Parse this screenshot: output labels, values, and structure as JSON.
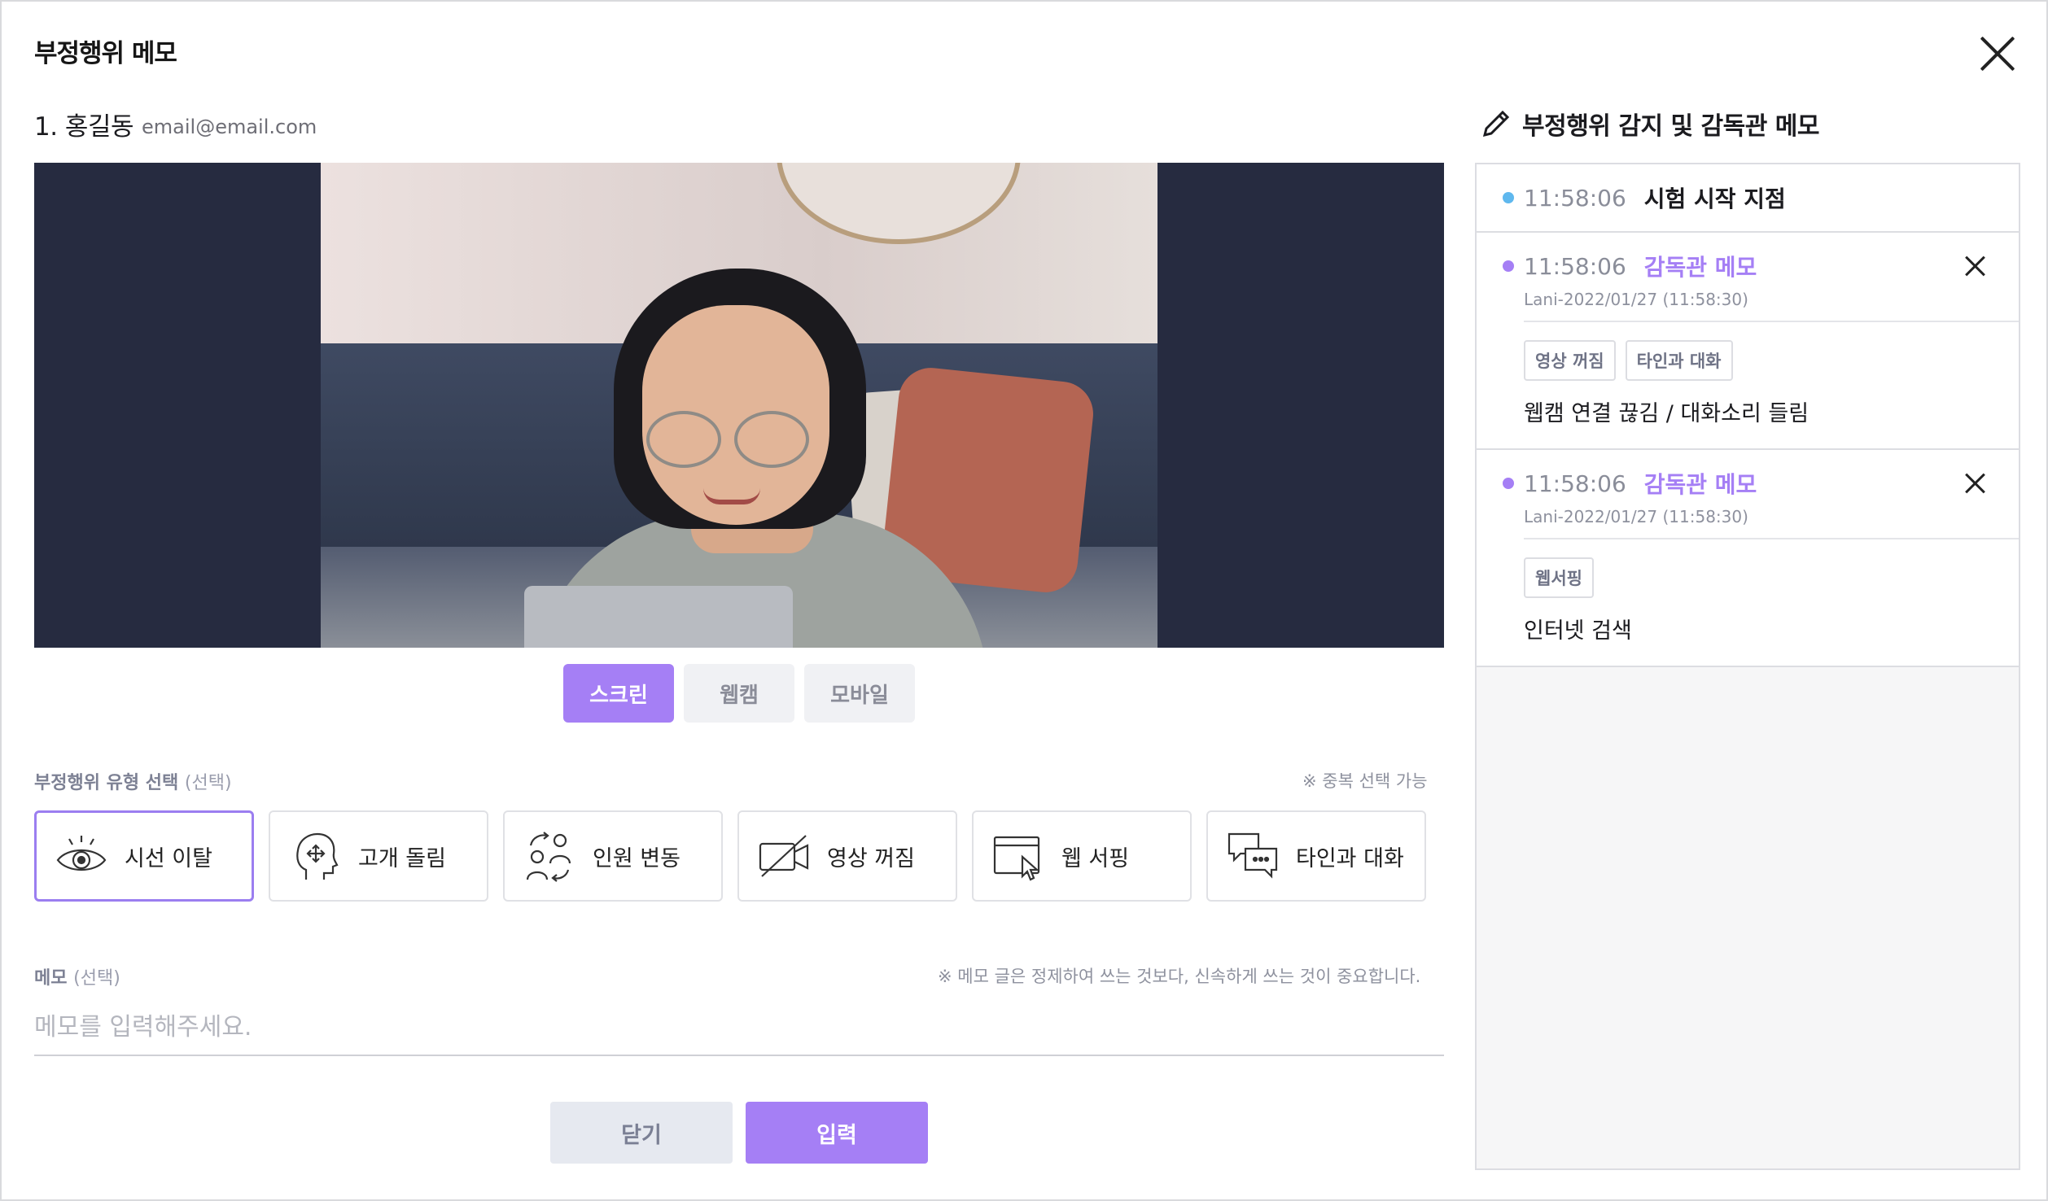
{
  "dialog": {
    "title": "부정행위 메모"
  },
  "candidate": {
    "name": "1. 홍길동",
    "email": "email@email.com"
  },
  "view_tabs": [
    {
      "label": "스크린",
      "active": true
    },
    {
      "label": "웹캠",
      "active": false
    },
    {
      "label": "모바일",
      "active": false
    }
  ],
  "type_section": {
    "label": "부정행위 유형 선택",
    "optional": "(선택)",
    "hint": "※ 중복 선택 가능"
  },
  "types": [
    {
      "label": "시선 이탈",
      "icon": "eye-icon",
      "selected": true
    },
    {
      "label": "고개 돌림",
      "icon": "head-turn-icon",
      "selected": false
    },
    {
      "label": "인원 변동",
      "icon": "people-change-icon",
      "selected": false
    },
    {
      "label": "영상 꺼짐",
      "icon": "video-off-icon",
      "selected": false
    },
    {
      "label": "웹 서핑",
      "icon": "web-cursor-icon",
      "selected": false
    },
    {
      "label": "타인과 대화",
      "icon": "chat-icon",
      "selected": false
    }
  ],
  "memo": {
    "label": "메모",
    "optional": "(선택)",
    "hint": "※ 메모 글은 정제하여 쓰는 것보다, 신속하게 쓰는 것이 중요합니다.",
    "placeholder": "메모를 입력해주세요.",
    "value": ""
  },
  "buttons": {
    "close": "닫기",
    "submit": "입력"
  },
  "sidebar": {
    "title": "부정행위 감지 및 감독관 메모",
    "entries": [
      {
        "time": "11:58:06",
        "title": "시험 시작 지점",
        "dot_color": "#5fb8ee",
        "title_color": "#1b1b1f"
      },
      {
        "time": "11:58:06",
        "title": "감독관 메모",
        "dot_color": "#a57ff5",
        "title_color": "#a57ff5",
        "log": "Lani-2022/01/27 (11:58:30)",
        "tags": [
          "영상 꺼짐",
          "타인과 대화"
        ],
        "text": "웹캠 연결 끊김 / 대화소리 들림"
      },
      {
        "time": "11:58:06",
        "title": "감독관 메모",
        "dot_color": "#a57ff5",
        "title_color": "#a57ff5",
        "log": "Lani-2022/01/27 (11:58:30)",
        "tags": [
          "웹서핑"
        ],
        "text": "인터넷 검색"
      }
    ]
  },
  "colors": {
    "accent": "#a57ff5",
    "start_dot": "#5fb8ee"
  }
}
